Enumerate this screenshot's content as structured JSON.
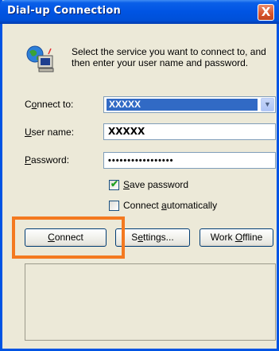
{
  "window": {
    "title": "Dial-up Connection",
    "close_glyph": "X"
  },
  "description": "Select the service you want to connect to, and then enter your user name and password.",
  "form": {
    "connect_to": {
      "label_pre": "C",
      "label_acc": "o",
      "label_post": "nnect to:",
      "value": "XXXXX"
    },
    "user_name": {
      "label_pre": "",
      "label_acc": "U",
      "label_post": "ser name:",
      "value": "XXXXX"
    },
    "password": {
      "label_pre": "",
      "label_acc": "P",
      "label_post": "assword:",
      "value": "•••••••••••••••••"
    }
  },
  "options": {
    "save_password": {
      "checked": true,
      "label_pre": "",
      "label_acc": "S",
      "label_post": "ave password"
    },
    "connect_automatically": {
      "checked": false,
      "label_pre": "Connect ",
      "label_acc": "a",
      "label_post": "utomatically"
    }
  },
  "buttons": {
    "connect": {
      "pre": "",
      "acc": "C",
      "post": "onnect"
    },
    "settings": {
      "pre": "S",
      "acc": "e",
      "post": "ttings..."
    },
    "work_offline": {
      "pre": "Work ",
      "acc": "O",
      "post": "ffline"
    }
  },
  "icons": {
    "network": "globe-computer-icon",
    "dropdown": "chevron-down-icon"
  },
  "colors": {
    "titlebar": "#0054e3",
    "dialog_bg": "#ece9d8",
    "highlight": "#f47920",
    "selection": "#316ac5"
  }
}
